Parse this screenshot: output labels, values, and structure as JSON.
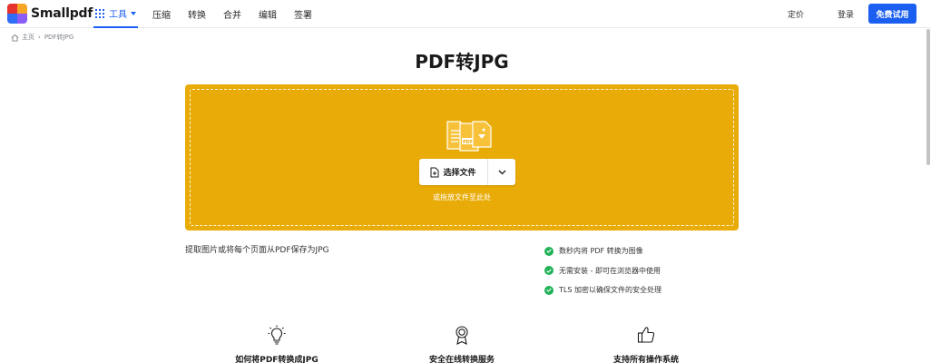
{
  "header": {
    "logo_text": "Smallpdf",
    "tools_label": "工具",
    "nav": [
      "压缩",
      "转换",
      "合并",
      "编辑",
      "签署"
    ],
    "pricing_label": "定价",
    "login_label": "登录",
    "trial_label": "免费试用"
  },
  "breadcrumb": {
    "home": "主页",
    "separator": "›",
    "current": "PDF转JPG"
  },
  "page": {
    "title": "PDF转JPG",
    "select_file_label": "选择文件",
    "drop_hint": "或拖放文件至此处",
    "description": "提取图片或将每个页面从PDF保存为JPG",
    "features": [
      "数秒内将 PDF 转换为图像",
      "无需安装 - 即可在浏览器中使用",
      "TLS 加密以确保文件的安全处理"
    ]
  },
  "sections": [
    {
      "icon": "lightbulb-icon",
      "title": "如何将PDF转换成JPG"
    },
    {
      "icon": "award-badge-icon",
      "title": "安全在线转换服务"
    },
    {
      "icon": "thumbs-up-icon",
      "title": "支持所有操作系统"
    }
  ],
  "colors": {
    "accent": "#1b5ff0",
    "dropzone": "#e8ab07",
    "check": "#22b359"
  }
}
